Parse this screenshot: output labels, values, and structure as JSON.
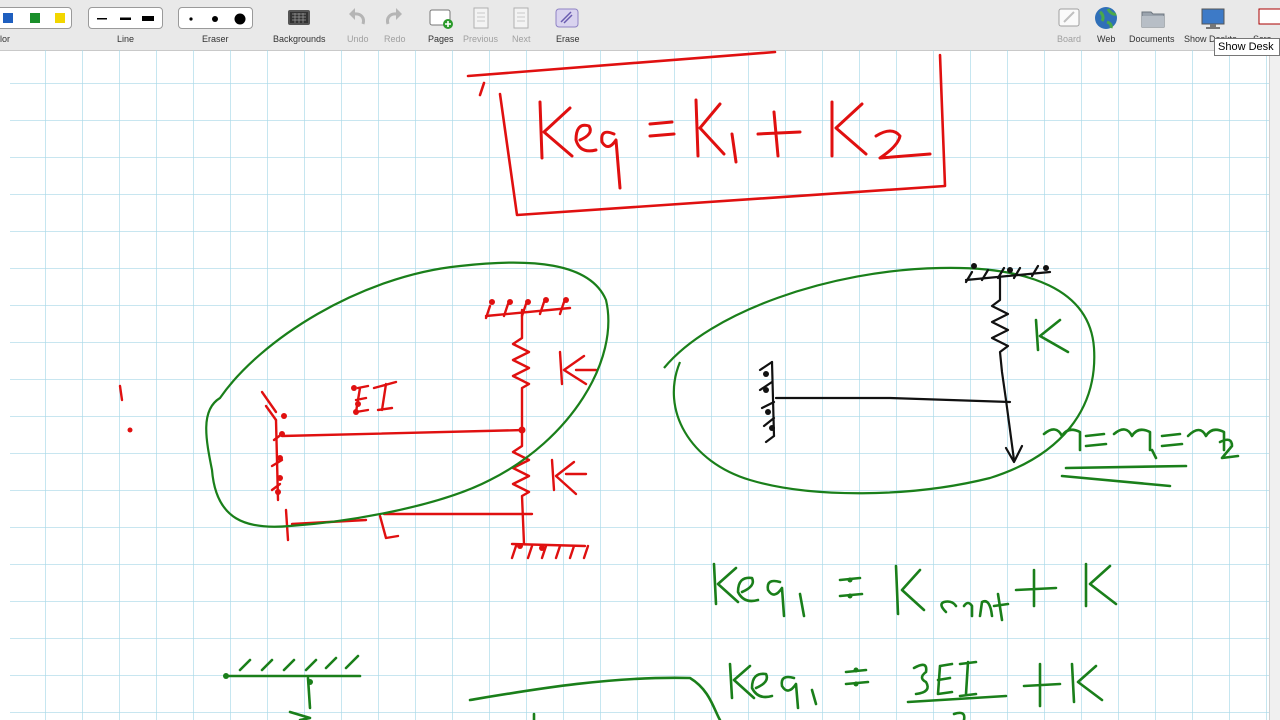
{
  "toolbar": {
    "color_label": "lor",
    "line_label": "Line",
    "eraser_label": "Eraser",
    "backgrounds_label": "Backgrounds",
    "undo_label": "Undo",
    "redo_label": "Redo",
    "pages_label": "Pages",
    "previous_label": "Previous",
    "next_label": "Next",
    "erase_label": "Erase",
    "board_label": "Board",
    "web_label": "Web",
    "documents_label": "Documents",
    "show_desktop_label": "Show Deskto",
    "cut_label": "Scre",
    "colors": [
      "#1f5fbf",
      "#1a8f2a",
      "#f2d600"
    ],
    "icons": [
      "color-swatch-icon",
      "line-width-icon",
      "eraser-size-icon",
      "backgrounds-icon",
      "undo-icon",
      "redo-icon",
      "add-page-icon",
      "previous-page-icon",
      "next-page-icon",
      "erase-icon",
      "board-icon",
      "web-globe-icon",
      "documents-folder-icon",
      "show-desktop-icon"
    ]
  },
  "tooltip": {
    "text": "Show Desk"
  },
  "whiteboard": {
    "grid_color": "#a8d8e8",
    "ink_colors": {
      "red": "#e01010",
      "green": "#1a7f1a",
      "black": "#111111"
    },
    "formula_top": "keq = k1 + k2",
    "label_EI": "EI",
    "label_k_red_upper": "k",
    "label_k_red_lower": "k",
    "label_L": "L",
    "label_k_green": "K",
    "eq_x": "x = x1 = x2",
    "eq_keq1": "keq1 = Kcant + K",
    "eq_keq1b": "keq1 = 3EI + K"
  }
}
